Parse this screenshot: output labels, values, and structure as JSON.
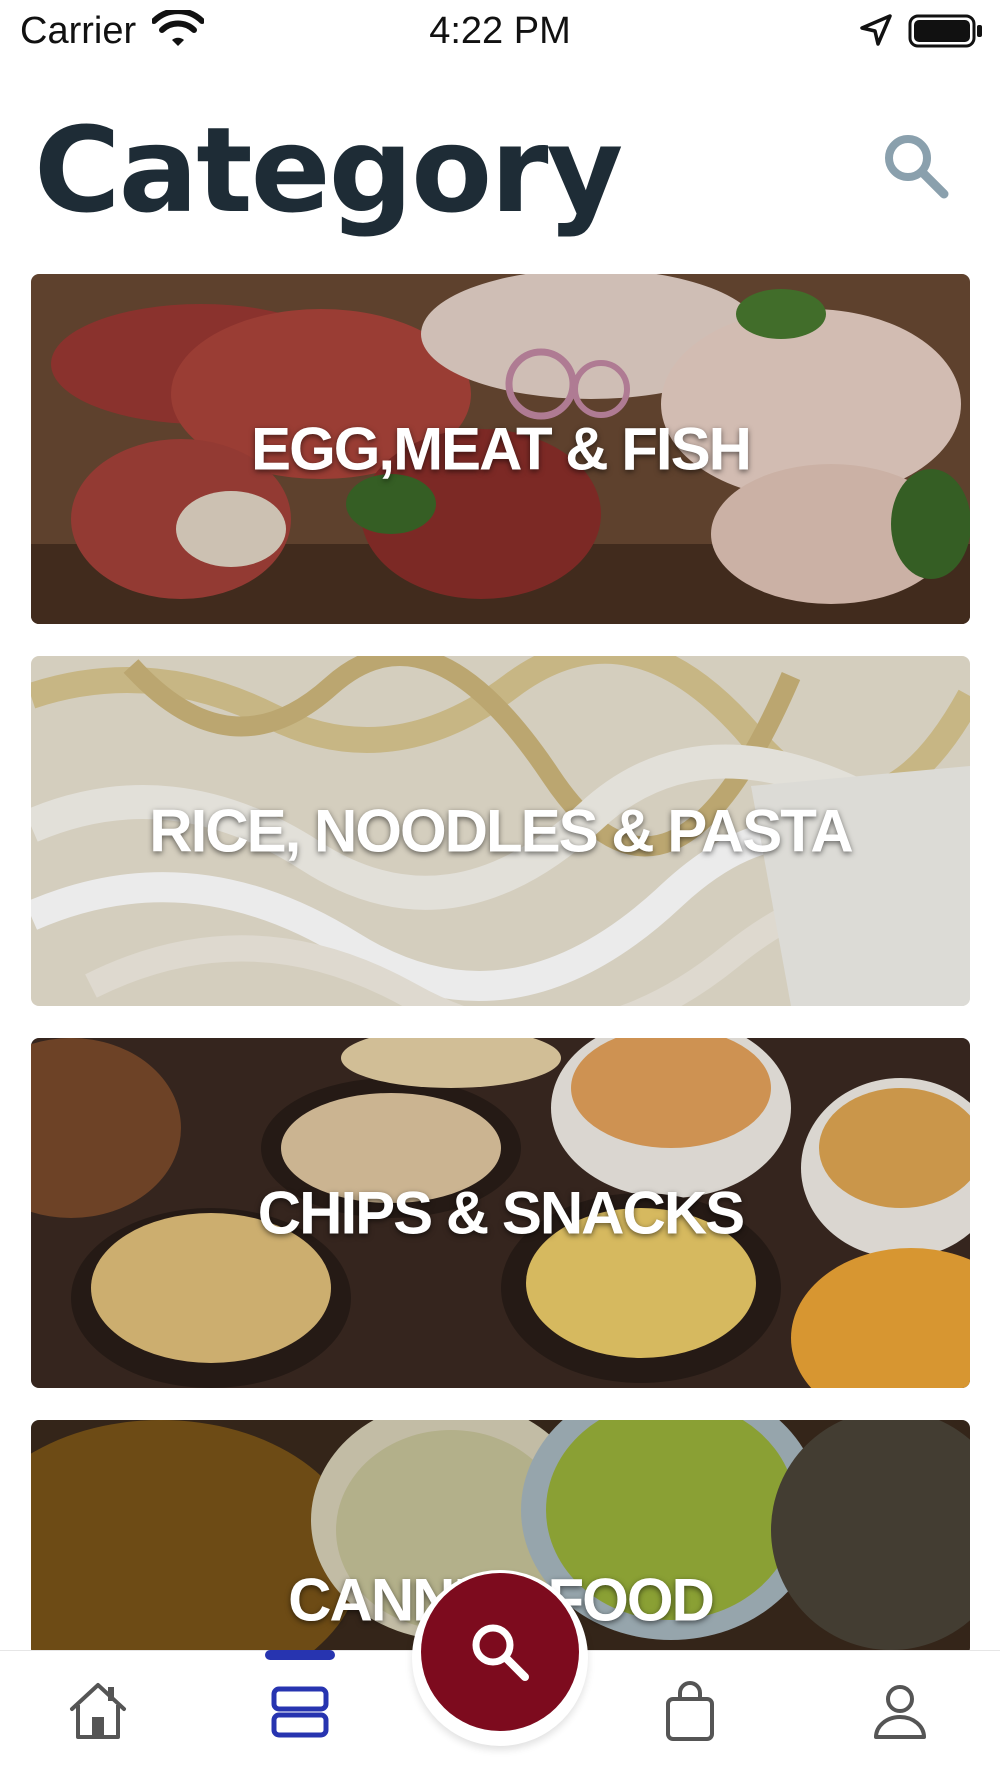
{
  "status_bar": {
    "carrier": "Carrier",
    "time": "4:22 PM",
    "icons": [
      "wifi-icon",
      "location-arrow-icon",
      "battery-icon"
    ]
  },
  "header": {
    "title": "Category",
    "search_icon": "search-icon"
  },
  "categories": [
    {
      "label": "EGG,MEAT & FISH"
    },
    {
      "label": "RICE, NOODLES & PASTA"
    },
    {
      "label": "CHIPS & SNACKS"
    },
    {
      "label": "CANNED FOOD"
    }
  ],
  "tab_bar": {
    "items": [
      {
        "icon": "home-icon",
        "active": false
      },
      {
        "icon": "categories-icon",
        "active": true
      },
      {
        "icon": "search-icon",
        "active": false
      },
      {
        "icon": "shopping-bag-icon",
        "active": false
      },
      {
        "icon": "user-icon",
        "active": false
      }
    ]
  },
  "colors": {
    "title": "#1e2c36",
    "search_icon": "#8aa0ad",
    "fab": "#7d0b1e",
    "active_tab": "#2734b0",
    "inactive_tab": "#555555"
  }
}
